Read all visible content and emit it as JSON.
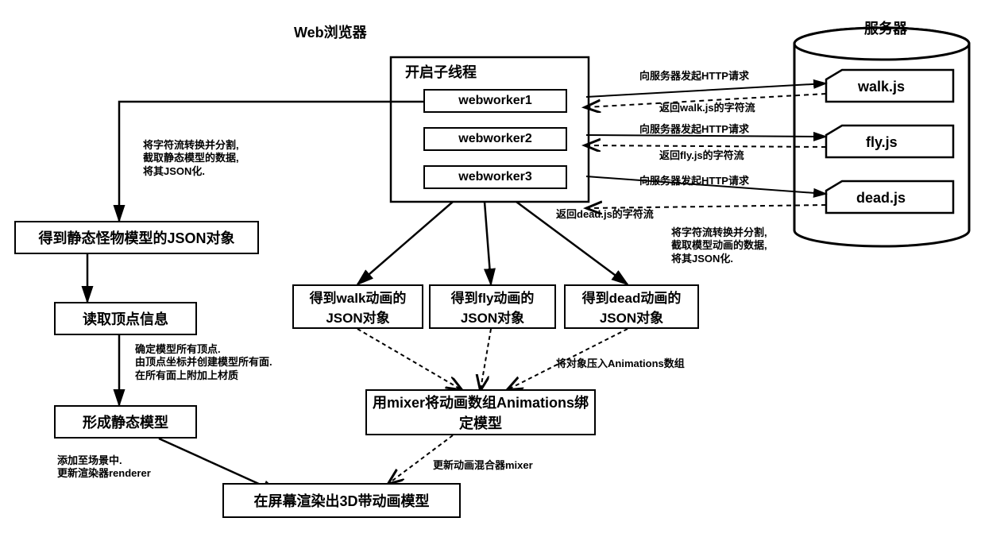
{
  "labels": {
    "web_browser": "Web浏览器",
    "server": "服务器",
    "thread_box_title": "开启子线程",
    "ww1": "webworker1",
    "ww2": "webworker2",
    "ww3": "webworker3",
    "walkjs": "walk.js",
    "flyjs": "fly.js",
    "deadjs": "dead.js",
    "static_json": "得到静态怪物模型的JSON对象",
    "read_vertex": "读取顶点信息",
    "form_static": "形成静态模型",
    "walk_json": "得到walk动画的JSON对象",
    "fly_json": "得到fly动画的JSON对象",
    "dead_json": "得到dead动画的JSON对象",
    "mixer_bind": "用mixer将动画数组Animations绑定模型",
    "render_3d": "在屏幕渲染出3D带动画模型"
  },
  "notes": {
    "split_static": "将字符流转换并分割,\n截取静态模型的数据,\n将其JSON化.",
    "vertex_note": "确定模型所有顶点.\n由顶点坐标并创建模型所有面.\n在所有面上附加上材质",
    "add_scene": "添加至场景中.\n更新渲染器renderer",
    "http_req": "向服务器发起HTTP请求",
    "ret_walk": "返回walk.js的字符流",
    "ret_fly": "返回fly.js的字符流",
    "ret_dead": "返回dead.js的字符流",
    "split_anim": "将字符流转换并分割,\n截取模型动画的数据,\n将其JSON化.",
    "push_anim": "将对象压入Animations数组",
    "update_mixer": "更新动画混合器mixer"
  }
}
